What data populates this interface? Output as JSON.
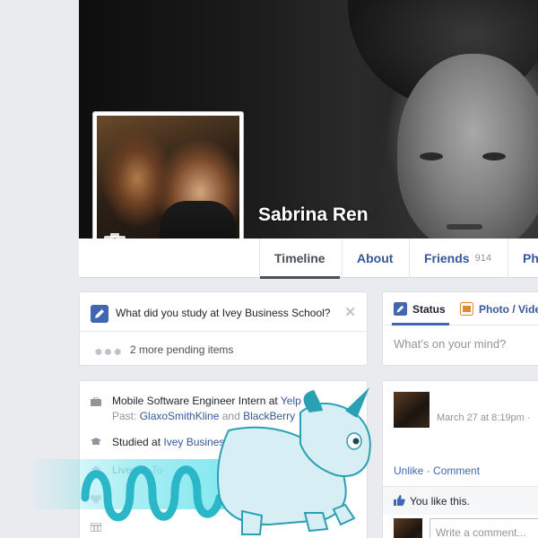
{
  "profile": {
    "name": "Sabrina Ren"
  },
  "nav": {
    "tabs": [
      {
        "label": "Timeline"
      },
      {
        "label": "About"
      },
      {
        "label": "Friends",
        "count": "914"
      },
      {
        "label": "Ph"
      }
    ]
  },
  "pending": {
    "question": "What did you study at Ivey Business School?",
    "more": "2 more pending items"
  },
  "intro": {
    "job_prefix": "Mobile Software Engineer Intern at ",
    "job_company": "Yelp",
    "past_label": "Past: ",
    "past_company1": "GlaxoSmithKline",
    "past_and": " and ",
    "past_company2": "BlackBerry",
    "study_prefix": "Studied at ",
    "study_school": "Ivey Business Scho",
    "lives_prefix": "Lives in ",
    "lives_place": "To"
  },
  "composer": {
    "status_label": "Status",
    "photo_label": "Photo / Vide",
    "placeholder": "What's on your mind?"
  },
  "post": {
    "date": "March 27 at 8:19pm ·",
    "unlike": "Unlike",
    "sep": " · ",
    "comment": "Comment",
    "likes": "You like this.",
    "comment_placeholder": "Write a comment..."
  },
  "colors": {
    "link": "#365899",
    "accent": "#4267b2",
    "background": "#e9ebee"
  },
  "icons": [
    "camera-icon",
    "pencil-icon",
    "close-icon",
    "briefcase-icon",
    "graduation-cap-icon",
    "home-icon",
    "photo-icon",
    "like-icon",
    "unicorn-sticker"
  ]
}
